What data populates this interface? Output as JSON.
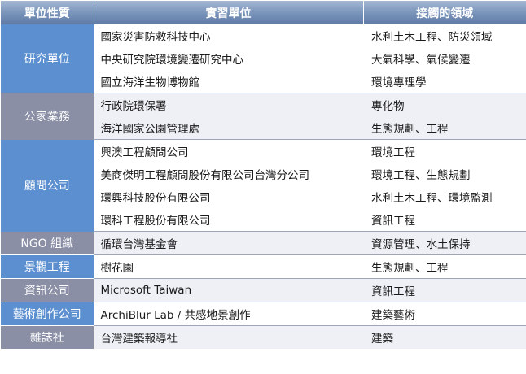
{
  "header": {
    "col1": "單位性質",
    "col2": "實習單位",
    "col3": "接觸的領域"
  },
  "groups": [
    {
      "category": "研究單位",
      "rows": [
        {
          "unit": "國家災害防救科技中心",
          "field": "水利土木工程、防災領域"
        },
        {
          "unit": "中央研究院環境變遷研究中心",
          "field": "大氣科學、氣候變遷"
        },
        {
          "unit": "國立海洋生物博物館",
          "field": "環境專理學"
        }
      ]
    },
    {
      "category": "公家業務",
      "rows": [
        {
          "unit": "行政院環保署",
          "field": "專化物"
        },
        {
          "unit": "海洋國家公園管理處",
          "field": "生態規劃、工程"
        }
      ]
    },
    {
      "category": "顧問公司",
      "rows": [
        {
          "unit": "興澳工程顧問公司",
          "field": "環境工程"
        },
        {
          "unit": "美商傑明工程顧問股份有限公司台灣分公司",
          "field": "環境工程、生態規劃"
        },
        {
          "unit": "環興科技股份有限公司",
          "field": "水利土木工程、環境監測"
        },
        {
          "unit": "環科工程股份有限公司",
          "field": "資訊工程"
        }
      ]
    },
    {
      "category": "NGO 組織",
      "rows": [
        {
          "unit": "循環台灣基金會",
          "field": "資源管理、水土保持"
        }
      ]
    },
    {
      "category": "景觀工程",
      "rows": [
        {
          "unit": "樹花園",
          "field": "生態規劃、工程"
        }
      ]
    },
    {
      "category": "資訊公司",
      "rows": [
        {
          "unit": "Microsoft Taiwan",
          "field": "資訊工程"
        }
      ]
    },
    {
      "category": "藝術創作公司",
      "rows": [
        {
          "unit": "ArchiBlur Lab / 共感地景創作",
          "field": "建築藝術"
        }
      ]
    },
    {
      "category": "雜誌社",
      "rows": [
        {
          "unit": "台灣建築報導社",
          "field": "建築"
        }
      ]
    }
  ],
  "colors": {
    "header_gradient": [
      "#a4b8d4",
      "#5e7aa6"
    ],
    "category_blue": "#5b8fd0",
    "category_gray": "#8a8fa6",
    "alt_row": "#eef0f5"
  }
}
